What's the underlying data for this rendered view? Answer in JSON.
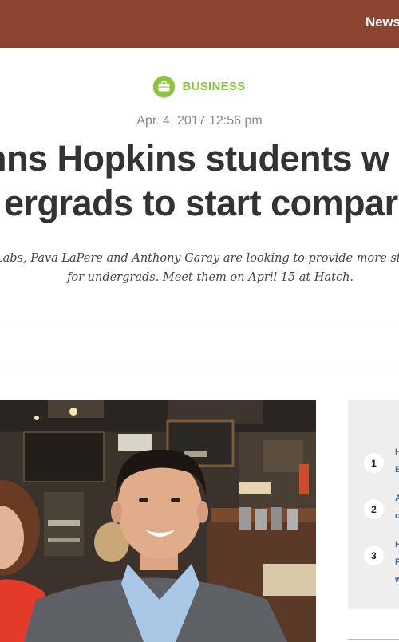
{
  "header": {
    "nav_label": "News"
  },
  "article": {
    "category": "BUSINESS",
    "date": "Apr. 4, 2017 12:56 pm",
    "headline_line1": "nns Hopkins students w",
    "headline_line2": "ergrads to start compar",
    "dek_line1": "Labs, Pava LaPere and Anthony Garay are looking to provide more startu",
    "dek_line2": "for undergrads. Meet them on April 15 at Hatch."
  },
  "colors": {
    "header_bg": "#8b4430",
    "category_green": "#8bc53f",
    "link_blue": "#3d6fa5"
  },
  "icons": {
    "category": "briefcase-icon"
  },
  "sidebar": {
    "items": [
      {
        "rank": "1",
        "line1": "H",
        "line2": "B"
      },
      {
        "rank": "2",
        "line1": "A",
        "line2": "c"
      },
      {
        "rank": "3",
        "line1": "H",
        "line2": "F",
        "line3": "w"
      }
    ]
  }
}
